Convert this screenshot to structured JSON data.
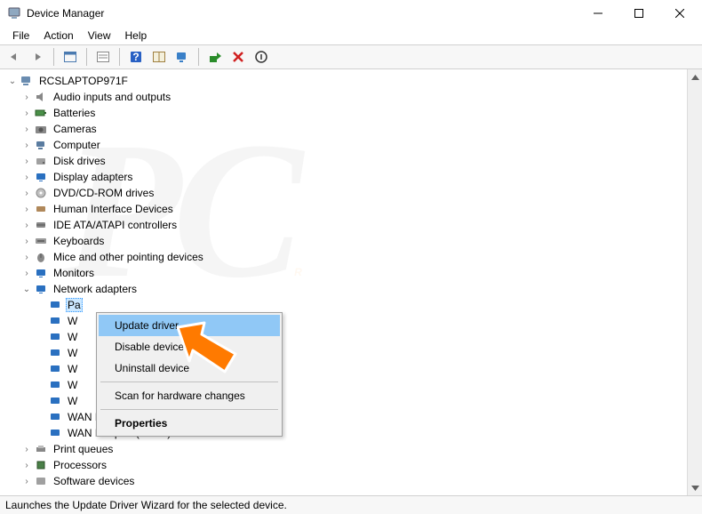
{
  "title": "Device Manager",
  "menubar": {
    "file": "File",
    "action": "Action",
    "view": "View",
    "help": "Help"
  },
  "root": "RCSLAPTOP971F",
  "cats": {
    "audio": "Audio inputs and outputs",
    "batt": "Batteries",
    "cam": "Cameras",
    "comp": "Computer",
    "disk": "Disk drives",
    "disp": "Display adapters",
    "dvd": "DVD/CD-ROM drives",
    "hid": "Human Interface Devices",
    "ide": "IDE ATA/ATAPI controllers",
    "kbd": "Keyboards",
    "mouse": "Mice and other pointing devices",
    "mon": "Monitors",
    "net": "Network adapters",
    "printq": "Print queues",
    "proc": "Processors",
    "soft": "Software devices"
  },
  "netitems": {
    "n0": "Pa",
    "n1": "W",
    "n2": "W",
    "n3": "W",
    "n4": "W",
    "n5": "W",
    "n6": "W",
    "n7": "WAN Miniport (PPTP)",
    "n8": "WAN Miniport (SSTP)"
  },
  "ctx": {
    "update": "Update driver",
    "disable": "Disable device",
    "uninstall": "Uninstall device",
    "scan": "Scan for hardware changes",
    "props": "Properties"
  },
  "status": "Launches the Update Driver Wizard for the selected device."
}
